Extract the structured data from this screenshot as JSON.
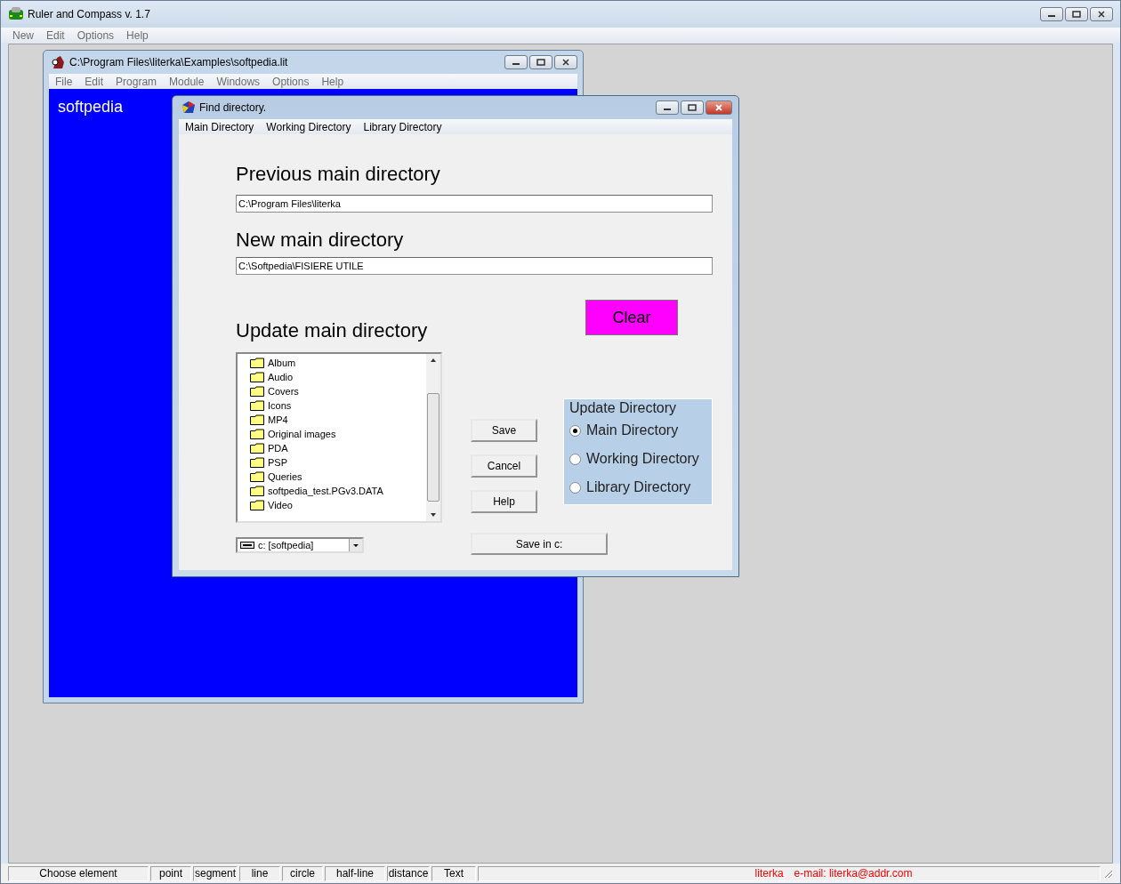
{
  "app": {
    "title": "Ruler and Compass v. 1.7",
    "menu": [
      "New",
      "Edit",
      "Options",
      "Help"
    ]
  },
  "child_window": {
    "title": "C:\\Program Files\\literka\\Examples\\softpedia.lit",
    "menu": [
      "File",
      "Edit",
      "Program",
      "Module",
      "Windows",
      "Options",
      "Help"
    ],
    "canvas_text": "softpedia"
  },
  "dialog": {
    "title": "Find directory.",
    "menu": [
      "Main Directory",
      "Working Directory",
      "Library Directory"
    ],
    "previous_label": "Previous main directory",
    "previous_value": "C:\\Program Files\\literka",
    "new_label": "New main directory",
    "new_value": "C:\\Softpedia\\FISIERE UTILE",
    "clear_button": "Clear",
    "update_label": "Update main directory",
    "folders": [
      "Album",
      "Audio",
      "Covers",
      "Icons",
      "MP4",
      "Original images",
      "PDA",
      "PSP",
      "Queries",
      "softpedia_test.PGv3.DATA",
      "Video"
    ],
    "drive": "c: [softpedia]",
    "buttons": [
      "Save",
      "Cancel",
      "Help"
    ],
    "save_in_button": "Save in c:",
    "update_group": {
      "title": "Update Directory",
      "options": [
        {
          "label": "Main Directory",
          "selected": true
        },
        {
          "label": "Working Directory",
          "selected": false
        },
        {
          "label": "Library Directory",
          "selected": false
        }
      ]
    }
  },
  "status_bar": {
    "items": [
      "Choose element",
      "point",
      "segment",
      "line",
      "circle",
      "half-line",
      "distance",
      "Text"
    ],
    "author": "literka",
    "email": "e-mail:  literka@addr.com"
  }
}
